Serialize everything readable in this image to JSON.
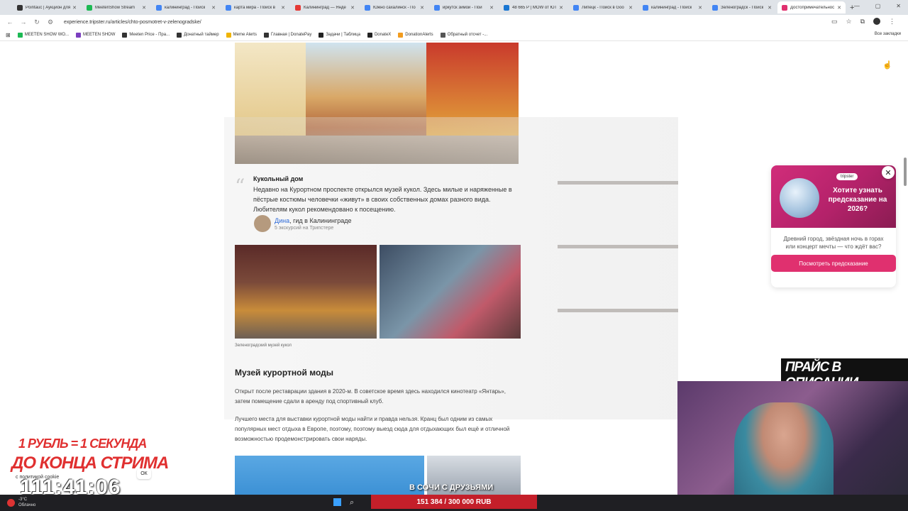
{
  "browser": {
    "tabs": [
      {
        "label": "Pointauc | Аукцион для",
        "color": "#333333"
      },
      {
        "label": "MeetenShow Stream",
        "color": "#1db954"
      },
      {
        "label": "калининград - Поиск",
        "color": "#4285f4"
      },
      {
        "label": "карта мира - Поиск в",
        "color": "#4285f4"
      },
      {
        "label": "Калининград — Янде",
        "color": "#e53935"
      },
      {
        "label": "Южно сахалинск - По",
        "color": "#4285f4"
      },
      {
        "label": "иркутск зимой - Пои",
        "color": "#4285f4"
      },
      {
        "label": "48 665 Р | MOW от ЮТ",
        "color": "#1976d2"
      },
      {
        "label": "Липецк - Поиск в Goo",
        "color": "#4285f4"
      },
      {
        "label": "калининград - Поиск",
        "color": "#4285f4"
      },
      {
        "label": "Зеленоградск - Поиск",
        "color": "#4285f4"
      },
      {
        "label": "Достопримечательнос",
        "color": "#e0306f",
        "active": true
      }
    ],
    "new_tab": "+",
    "url": "experience.tripster.ru/articles/chto-posmotret-v-zelenogradske/",
    "bookmarks": [
      {
        "label": "MEETEN SHOW WO...",
        "color": "#1db954"
      },
      {
        "label": "MEETEN SHOW",
        "color": "#7b3fbf"
      },
      {
        "label": "Meeten Price - Пра...",
        "color": "#333333"
      },
      {
        "label": "Донатный таймер",
        "color": "#333333"
      },
      {
        "label": "Meme Alerts",
        "color": "#f0b400"
      },
      {
        "label": "Главная | DonatePay",
        "color": "#333333"
      },
      {
        "label": "Задачи | Таблица",
        "color": "#222222"
      },
      {
        "label": "DonateX",
        "color": "#222222"
      },
      {
        "label": "DonationAlerts",
        "color": "#f29c1f"
      },
      {
        "label": "Обратный отсчет -...",
        "color": "#555555"
      }
    ],
    "all_bookmarks": "Все закладки"
  },
  "article": {
    "quote": {
      "title": "Кукольный дом",
      "text": "Недавно на Курортном проспекте открылся музей кукол. Здесь милые и наряженные в пёстрые костюмы человечки «живут» в своих собственных домах разного вида. Любителям кукол рекомендовано к посещению.",
      "guide_name": "Дина",
      "guide_role": ", гид в Калининграде",
      "guide_sub": "5 экскурсий на Трипстере"
    },
    "caption": "Зеленоградский музей кукол",
    "section_title": "Музей курортной моды",
    "para1": "Открыт после реставрации здания в 2020-м. В советское время здесь находился кинотеатр «Янтарь», затем помещение сдали в аренду под спортивный клуб.",
    "para2": "Лучшего места для выставки курортной моды найти и правда нельзя. Кранц был одним из самых популярных мест отдыха в Европе, поэтому, поэтому выезд сюда для отдыхающих был ещё и отличной возможностью продемонстрировать свои наряды."
  },
  "promo": {
    "logo": "tripster",
    "title": "Хотите узнать предсказание на 2026?",
    "text": "Древний город, звёздная ночь в горах или концерт мечты — что ждёт вас?",
    "button": "Посмотреть предсказание",
    "close": "✕"
  },
  "stream": {
    "price_banner": "ПРАЙС В ОПИСАНИИ",
    "timer_line1": "1 РУБЛЬ = 1 СЕКУНДА",
    "timer_line2": "ДО КОНЦА СТРИМА",
    "timer_value": "111:41:06",
    "cookie_text": "с политикой cookie",
    "cookie_ok": "ОК",
    "sochi": "В СОЧИ С ДРУЗЬЯМИ",
    "goal": "151 384 / 300 000 RUB"
  },
  "taskbar": {
    "weather_temp": "-3°C",
    "weather_desc": "Облачно"
  }
}
